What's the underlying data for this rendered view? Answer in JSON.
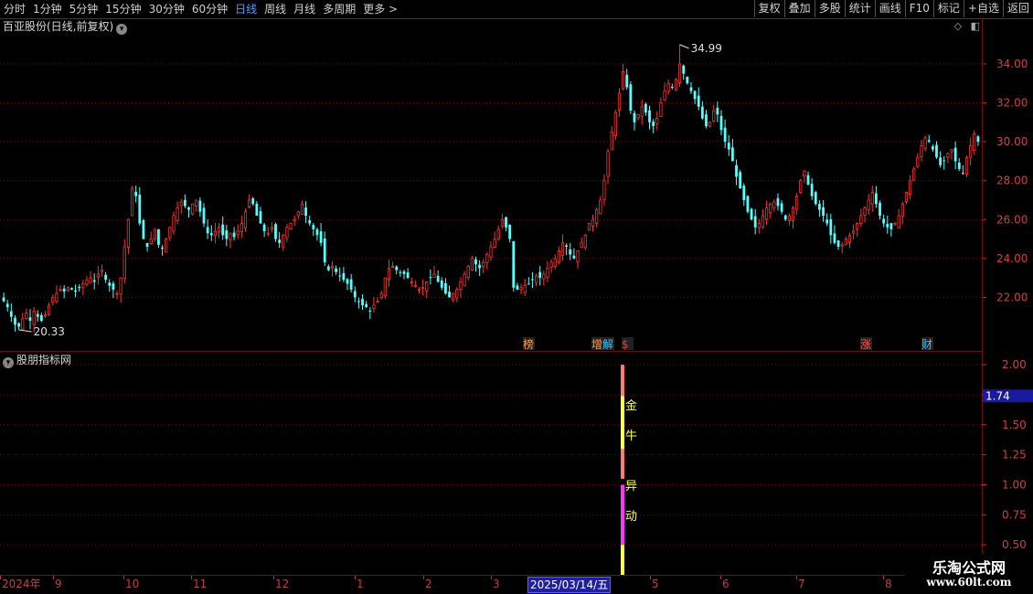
{
  "toolbar": {
    "periods": [
      "分时",
      "1分钟",
      "5分钟",
      "15分钟",
      "30分钟",
      "60分钟",
      "日线",
      "周线",
      "月线",
      "多周期",
      "更多 >"
    ],
    "active_period": "日线",
    "buttons": [
      "复权",
      "叠加",
      "多股",
      "统计",
      "画线",
      "F10",
      "标记",
      "+自选",
      "返回"
    ]
  },
  "main_chart": {
    "title": "百亚股份(日线,前复权)",
    "high_label": "34.99",
    "low_label": "20.33",
    "y_ticks": [
      "34.00",
      "32.00",
      "30.00",
      "28.00",
      "26.00",
      "24.00",
      "22.00"
    ],
    "markers": [
      {
        "text": "榜",
        "color": "#ff9a40"
      },
      {
        "text": "增",
        "color": "#ff9a40"
      },
      {
        "text": "解",
        "color": "#40c0ff"
      },
      {
        "text": "$",
        "color": "#ff3030"
      },
      {
        "text": "涨",
        "color": "#ff5050"
      },
      {
        "text": "财",
        "color": "#40c0ff"
      }
    ]
  },
  "indicator": {
    "title": "股朋指标网",
    "y_ticks": [
      "2.00",
      "1.75",
      "1.50",
      "1.25",
      "1.00",
      "0.75",
      "0.50"
    ],
    "current_value": "1.74",
    "signal_text_top": [
      "金",
      "牛"
    ],
    "signal_text_bottom": [
      "异",
      "动"
    ]
  },
  "date_axis": {
    "labels": [
      "2024年",
      "9",
      "10",
      "11",
      "12",
      "1",
      "2",
      "3",
      "5",
      "6",
      "7",
      "8"
    ],
    "cursor_date": "2025/03/14/五"
  },
  "watermark": {
    "title": "乐淘公式网",
    "url": "www.60lt.com"
  },
  "chart_data": {
    "type": "candlestick",
    "ylim": [
      20.0,
      35.5
    ],
    "high": 34.99,
    "low": 20.33,
    "closes": [
      21.8,
      21.5,
      21.0,
      20.6,
      20.5,
      20.9,
      21.2,
      20.8,
      21.3,
      21.0,
      20.8,
      21.1,
      21.6,
      22.0,
      22.2,
      22.4,
      22.3,
      22.5,
      22.4,
      22.3,
      22.5,
      22.7,
      22.9,
      23.0,
      22.8,
      23.2,
      23.4,
      22.9,
      22.6,
      22.4,
      22.2,
      23.0,
      24.6,
      26.0,
      27.6,
      27.2,
      25.8,
      25.0,
      24.6,
      25.0,
      25.5,
      24.7,
      24.5,
      25.0,
      25.6,
      26.2,
      26.6,
      26.9,
      26.7,
      26.5,
      26.8,
      27.0,
      26.4,
      25.8,
      25.3,
      25.2,
      25.4,
      25.6,
      25.2,
      25.0,
      25.3,
      25.1,
      25.4,
      25.8,
      26.4,
      27.0,
      26.8,
      26.2,
      25.8,
      25.4,
      25.3,
      25.6,
      25.0,
      24.8,
      25.2,
      25.6,
      25.8,
      26.0,
      26.4,
      26.8,
      26.2,
      25.8,
      25.5,
      25.2,
      24.8,
      23.8,
      23.4,
      23.6,
      23.3,
      23.1,
      22.9,
      22.7,
      22.4,
      22.0,
      21.8,
      21.6,
      21.5,
      21.3,
      21.6,
      21.8,
      22.2,
      23.0,
      23.5,
      23.6,
      23.4,
      23.3,
      23.2,
      23.0,
      22.8,
      22.6,
      22.4,
      22.5,
      22.8,
      23.0,
      23.2,
      22.8,
      22.5,
      22.2,
      22.0,
      22.2,
      22.4,
      22.8,
      23.2,
      23.6,
      24.0,
      23.7,
      23.5,
      23.8,
      24.2,
      24.6,
      25.0,
      25.5,
      26.0,
      25.6,
      25.0,
      22.5,
      22.4,
      22.5,
      22.6,
      22.7,
      22.9,
      23.1,
      23.0,
      23.2,
      23.5,
      23.8,
      24.0,
      24.4,
      24.8,
      24.6,
      24.2,
      24.0,
      24.4,
      24.8,
      25.2,
      25.8,
      26.0,
      26.5,
      27.0,
      28.0,
      29.5,
      30.5,
      31.5,
      32.5,
      33.6,
      32.8,
      31.6,
      31.0,
      31.4,
      31.8,
      31.5,
      31.0,
      30.8,
      31.2,
      32.0,
      32.6,
      33.0,
      32.8,
      33.2,
      34.0,
      33.5,
      33.0,
      32.6,
      32.2,
      31.8,
      31.2,
      30.8,
      31.0,
      31.6,
      31.4,
      30.6,
      30.0,
      29.6,
      29.0,
      28.2,
      27.6,
      27.0,
      26.4,
      26.0,
      25.6,
      25.8,
      26.2,
      26.6,
      26.8,
      26.9,
      26.7,
      26.4,
      26.0,
      26.2,
      26.6,
      27.2,
      28.0,
      28.5,
      27.8,
      27.2,
      26.8,
      26.5,
      26.2,
      25.8,
      25.2,
      24.8,
      24.6,
      24.7,
      25.0,
      25.2,
      25.4,
      25.8,
      26.2,
      26.6,
      27.0,
      27.4,
      26.8,
      26.2,
      25.8,
      25.6,
      25.5,
      25.8,
      26.2,
      26.8,
      27.4,
      28.0,
      28.6,
      29.2,
      29.8,
      30.2,
      30.0,
      29.6,
      29.2,
      28.8,
      29.0,
      29.4,
      29.6,
      29.0,
      28.6,
      28.4,
      29.2,
      29.8,
      30.4,
      30.0
    ],
    "indicator": {
      "signal_index": 0.634,
      "segments": [
        {
          "from": 2.0,
          "to": 1.05,
          "color": "#ff7a7a"
        },
        {
          "from": 1.74,
          "to": 1.3,
          "color": "#ffff33"
        },
        {
          "from": 1.0,
          "to": 0.5,
          "color": "#ff33ff"
        },
        {
          "from": 0.5,
          "to": -0.25,
          "color": "#ffff33"
        }
      ],
      "ylim": [
        0.25,
        2.1
      ]
    }
  }
}
